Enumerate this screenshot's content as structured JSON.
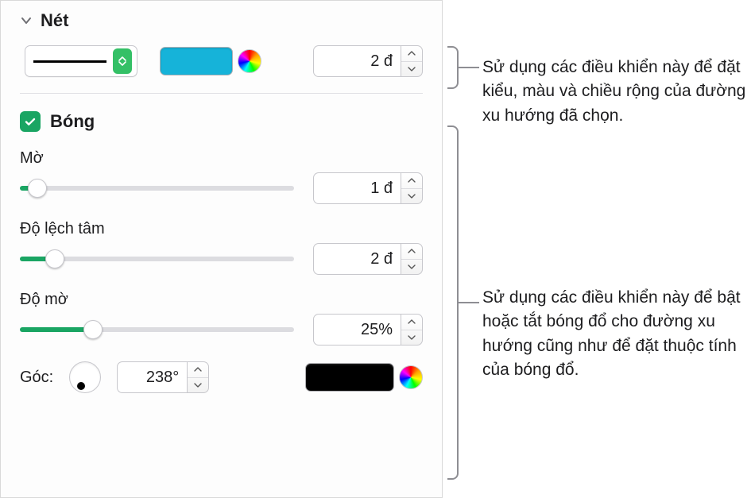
{
  "stroke": {
    "section_title": "Nét",
    "width_value": "2 đ",
    "color": "#16b3d9"
  },
  "shadow": {
    "checkbox_label": "Bóng",
    "blur_label": "Mờ",
    "blur_value": "1 đ",
    "offset_label": "Độ lệch tâm",
    "offset_value": "2 đ",
    "opacity_label": "Độ mờ",
    "opacity_value": "25%",
    "angle_label": "Góc:",
    "angle_value": "238°",
    "shadow_color": "#000000"
  },
  "callouts": {
    "stroke": "Sử dụng các điều khiển này để đặt kiểu, màu và chiều rộng của đường xu hướng đã chọn.",
    "shadow": "Sử dụng các điều khiển này để bật hoặc tắt bóng đổ cho đường xu hướng cũng như để đặt thuộc tính của bóng đổ."
  }
}
